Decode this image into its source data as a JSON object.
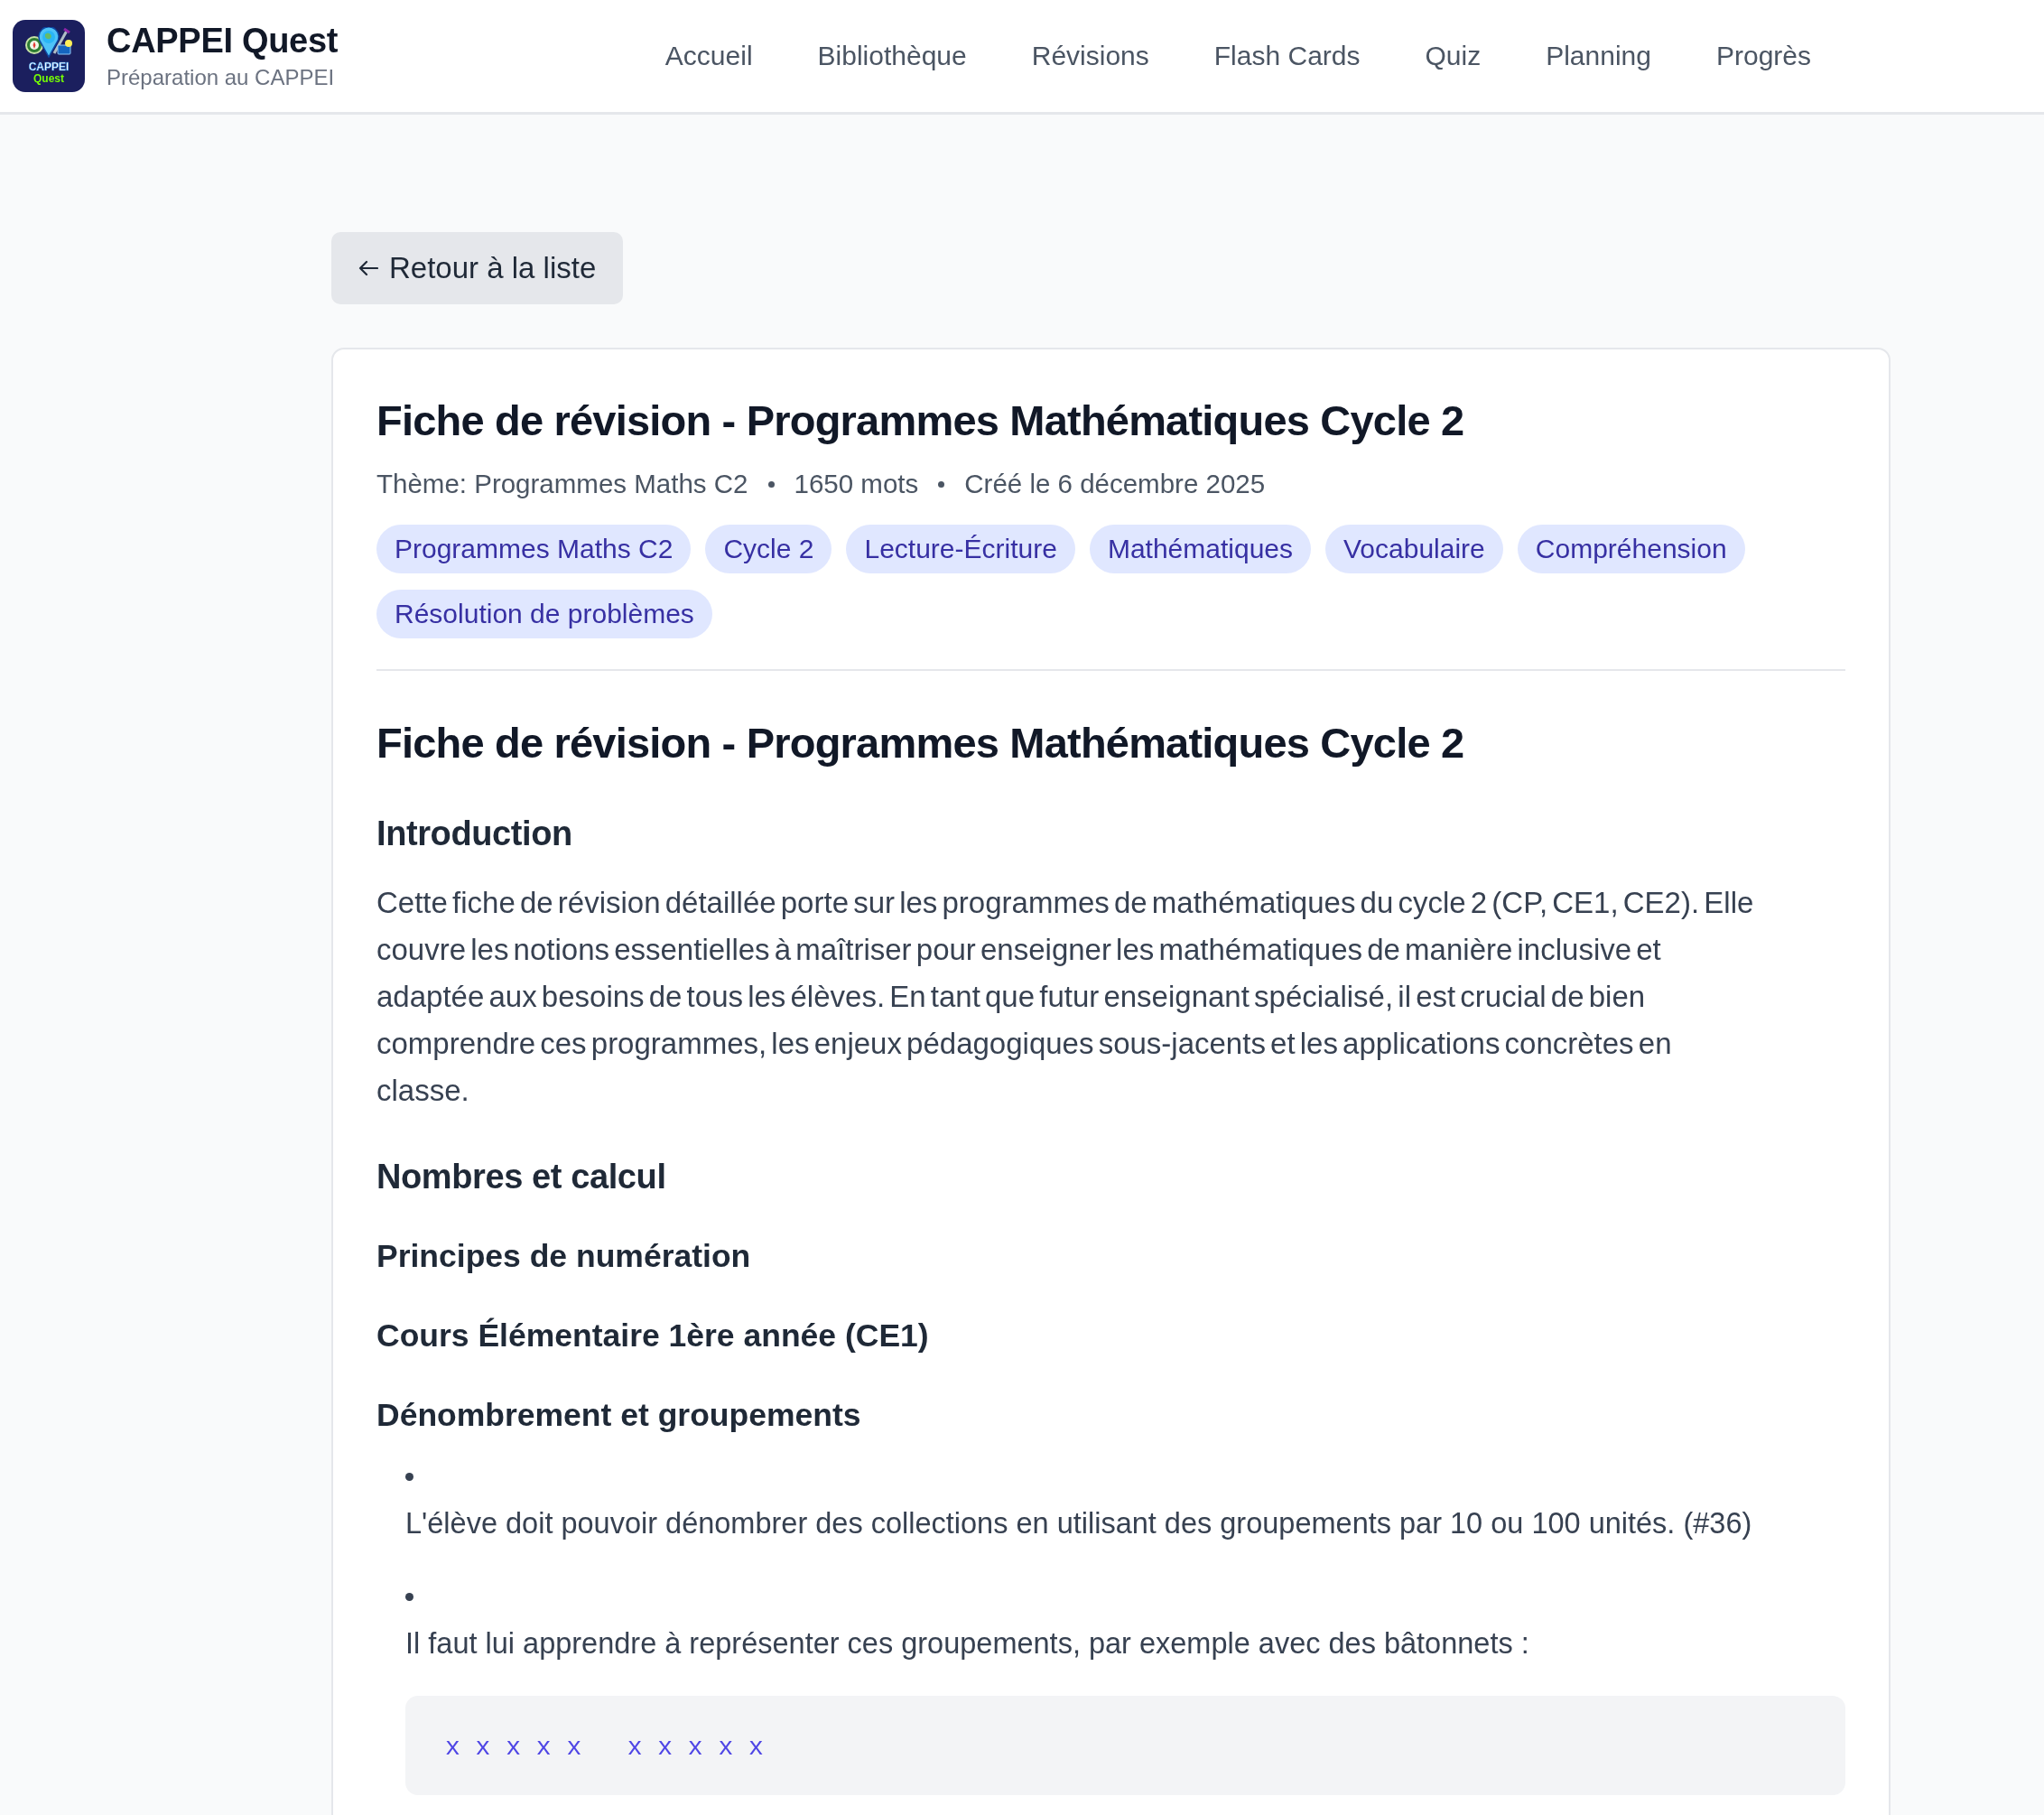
{
  "header": {
    "logo": {
      "line_1": "CAPPEI",
      "line_2": "Quest"
    },
    "title": "CAPPEI Quest",
    "subtitle": "Préparation au CAPPEI",
    "nav": [
      "Accueil",
      "Bibliothèque",
      "Révisions",
      "Flash Cards",
      "Quiz",
      "Planning",
      "Progrès"
    ]
  },
  "back_button": {
    "label": "Retour à la liste"
  },
  "sheet": {
    "title": "Fiche de révision - Programmes Mathématiques Cycle 2",
    "meta": [
      "Thème: Programmes Maths C2",
      "1650 mots",
      "Créé le 6 décembre 2025"
    ],
    "tags": [
      "Programmes Maths C2",
      "Cycle 2",
      "Lecture-Écriture",
      "Mathématiques",
      "Vocabulaire",
      "Compréhension",
      "Résolution de problèmes"
    ],
    "content": [
      {
        "kind": "h1",
        "text": "Fiche de révision - Programmes Mathématiques Cycle 2"
      },
      {
        "kind": "h2",
        "text": "Introduction"
      },
      {
        "kind": "paragraph",
        "text": "Cette fiche de révision détaillée porte sur les programmes de mathématiques du cycle 2 (CP, CE1, CE2). Elle couvre les notions essentielles à maîtriser pour enseigner les mathématiques de manière inclusive et adaptée aux besoins de tous les élèves. En tant que futur enseignant spécialisé, il est crucial de bien comprendre ces programmes, les enjeux pédagogiques sous-jacents et les applications concrètes en classe."
      },
      {
        "kind": "h2",
        "text": "Nombres et calcul"
      },
      {
        "kind": "h3",
        "text": "Principes de numération"
      },
      {
        "kind": "h3",
        "text": "Cours Élémentaire 1ère année (CE1)"
      },
      {
        "kind": "h3",
        "text": "Dénombrement et groupements"
      },
      {
        "kind": "list",
        "items": [
          "L'élève doit pouvoir dénombrer des collections en utilisant des groupements par 10 ou 100 unités. (#36)",
          "Il faut lui apprendre à représenter ces groupements, par exemple avec des bâtonnets :"
        ]
      },
      {
        "kind": "code",
        "text": "x x x x x   x x x x x"
      }
    ]
  }
}
